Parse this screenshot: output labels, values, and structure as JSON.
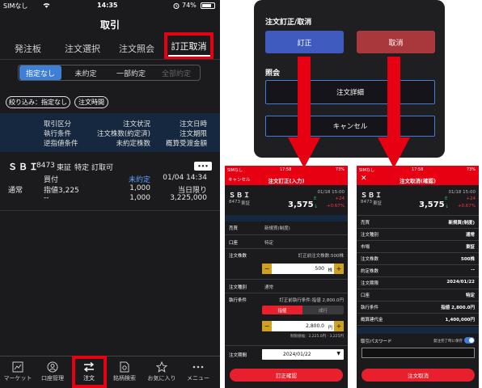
{
  "left": {
    "status": {
      "carrier": "SIMなし",
      "time": "14:35",
      "battery": "74%"
    },
    "title": "取引",
    "tabs": [
      "発注板",
      "注文選択",
      "注文照会",
      "訂正取消"
    ],
    "segments": [
      "指定なし",
      "未約定",
      "一部約定",
      "全部約定"
    ],
    "filter_label": "絞り込み：指定なし",
    "sort_label": "注文時間",
    "headers": [
      [
        "取引区分",
        "注文状況",
        "注文日時"
      ],
      [
        "執行条件",
        "注文株数(約定済)",
        "注文期限"
      ],
      [
        "逆指値条件",
        "未約定株数",
        "概算受渡金額"
      ]
    ],
    "order": {
      "name": "ＳＢＩ",
      "code": "8473",
      "market": "東証",
      "account": "特定",
      "correction": "訂取可",
      "side": "買付",
      "status": "未約定",
      "datetime": "01/04 14:34",
      "type": "通常",
      "price": "指値3,225",
      "qty": "1,000",
      "period": "当日限り",
      "stop": "--",
      "remaining": "1,000",
      "amount": "3,225,000",
      "more": "•••"
    },
    "nav": [
      "マーケット",
      "口座管理",
      "注文",
      "銘柄検索",
      "お気に入り",
      "メニュー"
    ]
  },
  "dialog": {
    "title": "注文訂正/取消",
    "correct": "訂正",
    "cancel_order": "取消",
    "inquiry": "照会",
    "detail": "注文詳細",
    "cancel": "キャンセル"
  },
  "mid": {
    "status": {
      "carrier": "SIMなし",
      "time": "17:58",
      "battery": "73%"
    },
    "back": "キャンセル",
    "title": "注文訂正(入力)",
    "stock": {
      "name": "ＳＢＩ",
      "code": "8473",
      "market": "東証",
      "time": "01/18 15:00",
      "price": "3,575",
      "flag": "E",
      "change": "+24",
      "pct": "+0.67%"
    },
    "rows": {
      "side_l": "売買",
      "side_v": "新規買(制度)",
      "acct_l": "口座",
      "acct_v": "特定",
      "qty_l": "注文株数",
      "qty_note": "訂正前注文株数:500株",
      "qty": "500",
      "qty_unit": "株",
      "type_l": "注文種別",
      "type_v": "通常",
      "cond_l": "執行条件",
      "cond_note": "訂正前執行条件:指値 2,800.0円",
      "tab_a": "指値",
      "tab_b": "成行",
      "price": "2,800.0",
      "price_unit": "円",
      "limit": "制限値幅：2,225.0円 - 3,225円",
      "period_l": "注文期間",
      "period_v": "2024/01/22"
    },
    "confirm": "訂正確認"
  },
  "right": {
    "status": {
      "carrier": "SIMなし",
      "time": "17:58",
      "battery": "73%"
    },
    "close": "✕",
    "title": "注文取消(確認)",
    "stock": {
      "name": "ＳＢＩ",
      "code": "8473",
      "market": "東証",
      "time": "01/18 15:00",
      "price": "3,575",
      "flag": "E",
      "change": "+24",
      "pct": "+0.67%"
    },
    "rows": [
      [
        "売買",
        "新規買(制度)"
      ],
      [
        "注文種別",
        "通常"
      ],
      [
        "市場",
        "東証"
      ],
      [
        "注文株数",
        "500株"
      ],
      [
        "約定株数",
        "--"
      ],
      [
        "注文期限",
        "2024/01/22"
      ],
      [
        "口座",
        "特定"
      ],
      [
        "執行条件",
        "指値 2,800.0円"
      ],
      [
        "概算建代金",
        "1,400,000円"
      ]
    ],
    "pw_label": "取引パスワード",
    "save_label": "発注完了時に保存",
    "submit": "注文取消"
  }
}
